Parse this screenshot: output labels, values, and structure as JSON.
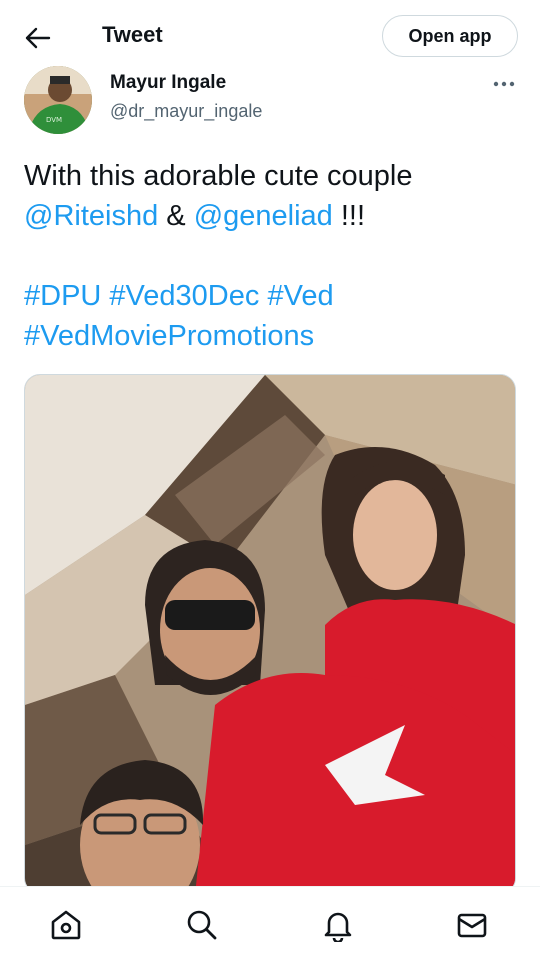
{
  "header": {
    "back_icon": "arrow-left-icon",
    "title": "Tweet",
    "open_app_label": "Open app"
  },
  "tweet": {
    "author_name": "Mayur Ingale",
    "author_handle": "@dr_mayur_ingale",
    "more_icon": "more-horizontal-icon",
    "text_line1": "With this adorable cute couple",
    "mention1": "@Riteishd",
    "and_text": " & ",
    "mention2": "@geneliad",
    "exclaim": "!!!",
    "hashtag1": "#DPU",
    "hashtag2": "#Ved30Dec",
    "hashtag3": "#Ved",
    "hashtag4": "#VedMoviePromotions"
  },
  "bottom_nav": [
    {
      "icon": "home-icon"
    },
    {
      "icon": "search-icon"
    },
    {
      "icon": "notifications-bell-icon"
    },
    {
      "icon": "messages-mail-icon"
    }
  ],
  "colors": {
    "link": "#1d9bf0",
    "text": "#0f1419",
    "secondary": "#536471",
    "shirt_red": "#d81b2c"
  }
}
